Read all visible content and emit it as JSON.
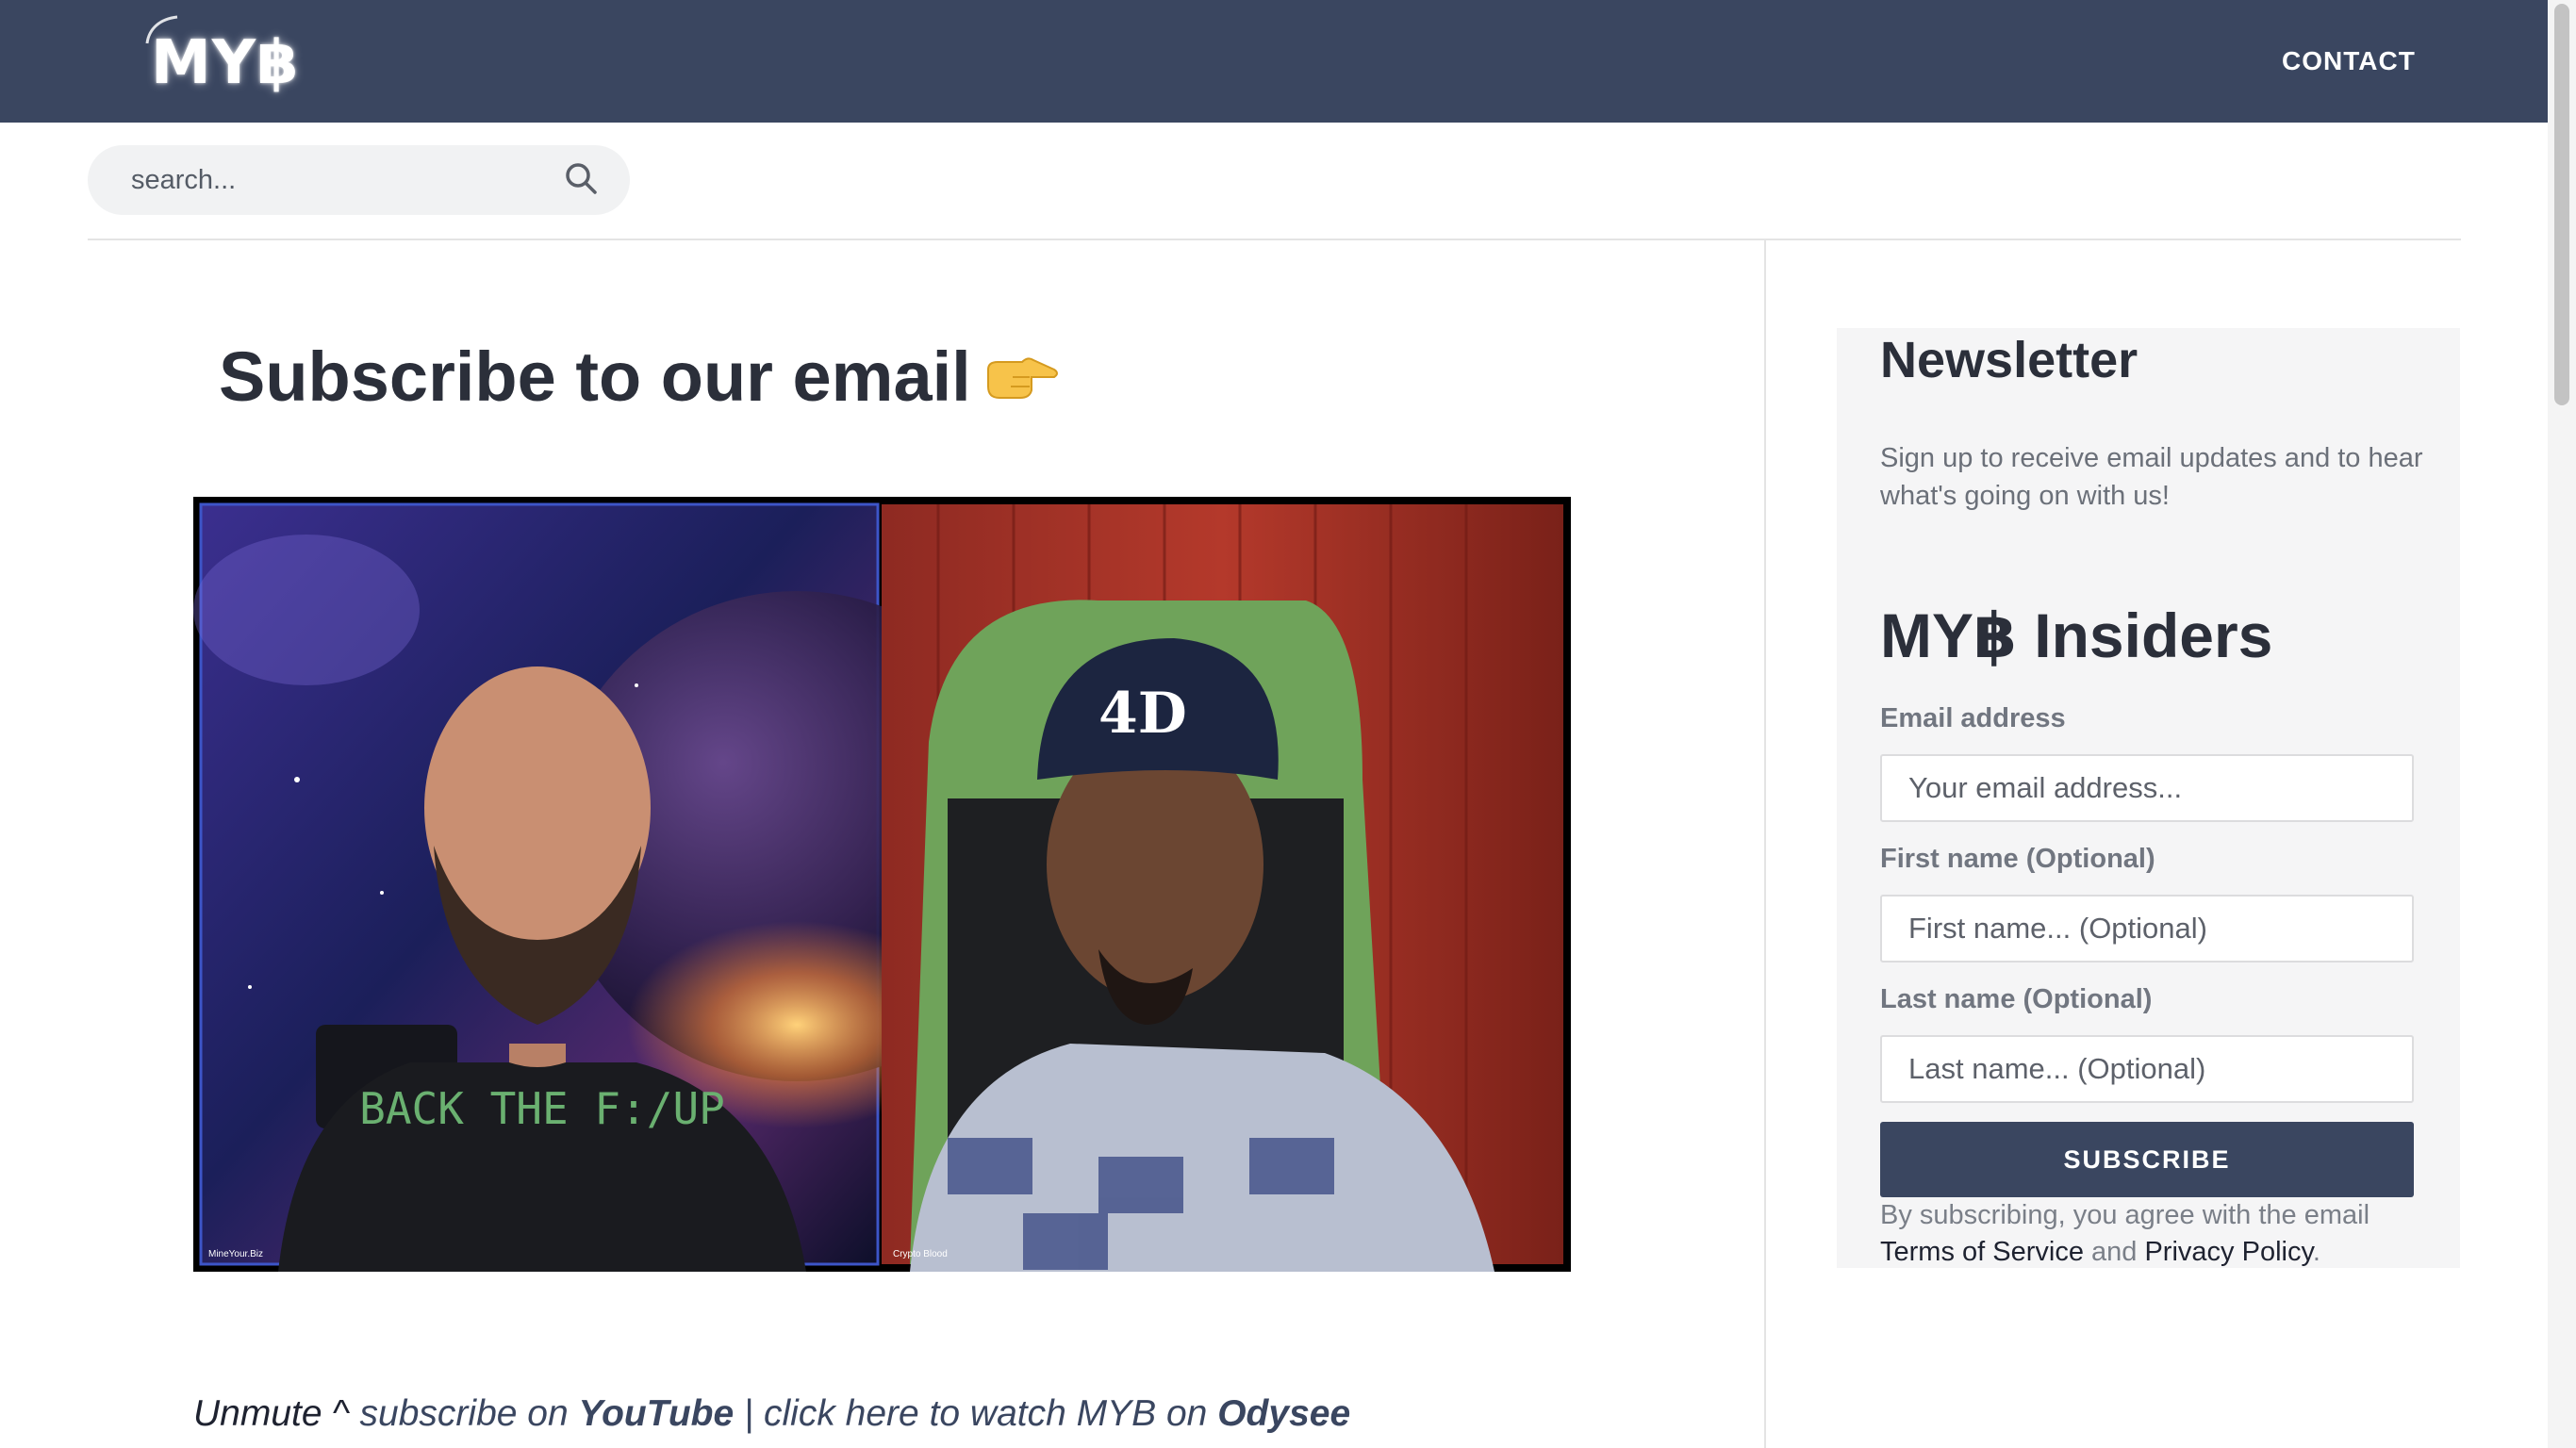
{
  "header": {
    "logo_text": "MY฿",
    "nav": {
      "contact_label": "CONTACT"
    }
  },
  "search": {
    "placeholder": "search..."
  },
  "main": {
    "title": "Subscribe to our email",
    "title_emoji": "pointing-right-hand",
    "video": {
      "left_tile_label": "MineYour.Biz",
      "right_tile_label": "Crypto Blood",
      "shirt_text": "BACK THE F:/UP"
    },
    "caption": {
      "lead": "Unmute ^",
      "part1": "subscribe on",
      "youtube_link": "YouTube",
      "part2": "| click here to watch MYB on",
      "odysee_link": "Odysee"
    }
  },
  "sidebar": {
    "newsletter_title": "Newsletter",
    "newsletter_desc": "Sign up to receive email updates and to hear what's going on with us!",
    "form_title": "MY฿ Insiders",
    "fields": [
      {
        "label": "Email address",
        "placeholder": "Your email address...",
        "value": ""
      },
      {
        "label": "First name (Optional)",
        "placeholder": "First name... (Optional)",
        "value": ""
      },
      {
        "label": "Last name (Optional)",
        "placeholder": "Last name... (Optional)",
        "value": ""
      }
    ],
    "subscribe_label": "SUBSCRIBE",
    "legal": {
      "prefix": "By subscribing, you agree with the email",
      "terms_link": "Terms of Service",
      "and": "and",
      "privacy_link": "Privacy Policy",
      "suffix": "."
    }
  },
  "colors": {
    "header_bg": "#3a4660",
    "accent": "#3a4660",
    "panel_bg": "#f5f5f6",
    "text_dark": "#2b2f3a",
    "text_muted": "#6b7079"
  }
}
